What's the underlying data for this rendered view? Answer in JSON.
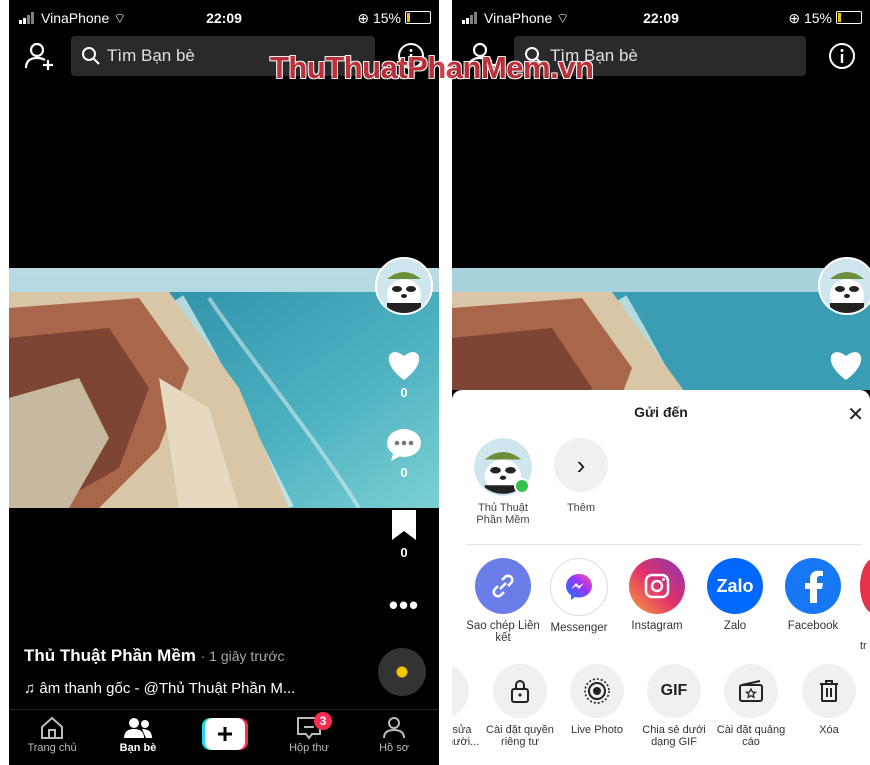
{
  "status": {
    "carrier": "VinaPhone",
    "time": "22:09",
    "battery": "15%"
  },
  "search": {
    "placeholder": "Tìm Bạn bè"
  },
  "watermark": "ThuThuatPhanMem.vn",
  "actions": {
    "like_count": "0",
    "comment_count": "0",
    "save_count": "0"
  },
  "post": {
    "author": "Thủ Thuật Phần Mềm",
    "time": "· 1 giây trước",
    "sound": "âm thanh gốc - @Thủ Thuật Phần M..."
  },
  "nav": {
    "items": [
      {
        "label": "Trang chủ"
      },
      {
        "label": "Bạn bè"
      },
      {
        "label": "Hộp thư",
        "badge": "3"
      },
      {
        "label": "Hồ sơ"
      }
    ]
  },
  "share": {
    "title": "Gửi đến",
    "contacts": [
      {
        "name": "Thủ Thuật Phần Mềm"
      },
      {
        "name": "Thêm"
      }
    ],
    "apps": [
      {
        "label": "Sao chép Liên kết",
        "color": "#6b7de8"
      },
      {
        "label": "Messenger",
        "color": "#ffffff"
      },
      {
        "label": "Instagram",
        "color": "#d6307a"
      },
      {
        "label": "Zalo",
        "color": "#0068ff"
      },
      {
        "label": "Facebook",
        "color": "#1877f2"
      }
    ],
    "partial_right": "tr",
    "actions": [
      {
        "label": "sửa nười..."
      },
      {
        "label": "Cài đặt quyền riêng tư"
      },
      {
        "label": "Live Photo"
      },
      {
        "label": "Chia sẻ dưới dạng GIF"
      },
      {
        "label": "Cài đặt quảng cáo"
      },
      {
        "label": "Xóa"
      }
    ],
    "gif_text": "GIF"
  }
}
